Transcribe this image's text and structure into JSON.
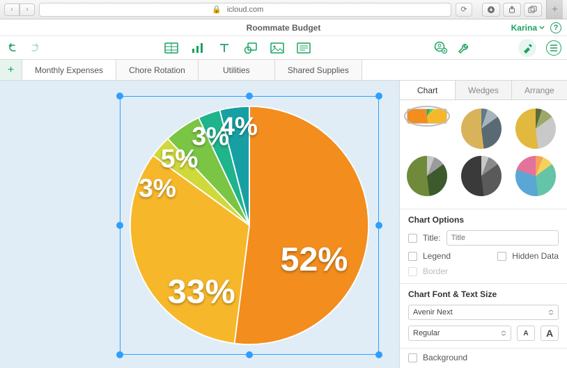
{
  "browser": {
    "domain": "icloud.com"
  },
  "document": {
    "title": "Roommate Budget",
    "user": "Karina"
  },
  "sheets": [
    "Monthly Expenses",
    "Chore Rotation",
    "Utilities",
    "Shared Supplies"
  ],
  "inspector": {
    "tabs": [
      "Chart",
      "Wedges",
      "Arrange"
    ],
    "options_header": "Chart Options",
    "title_label": "Title:",
    "title_placeholder": "Title",
    "legend_label": "Legend",
    "hidden_label": "Hidden Data",
    "border_label": "Border",
    "font_header": "Chart Font & Text Size",
    "font_family": "Avenir Next",
    "font_weight": "Regular",
    "size_small": "A",
    "size_big": "A",
    "background_label": "Background"
  },
  "chart_data": {
    "type": "pie",
    "values": [
      52,
      33,
      3,
      5,
      3,
      4
    ],
    "labels": [
      "52%",
      "33%",
      "3%",
      "5%",
      "3%",
      "4%"
    ],
    "colors": [
      "#f28d1e",
      "#f7b72a",
      "#cfd93c",
      "#7ac543",
      "#1fb48b",
      "#16a0a3"
    ]
  }
}
